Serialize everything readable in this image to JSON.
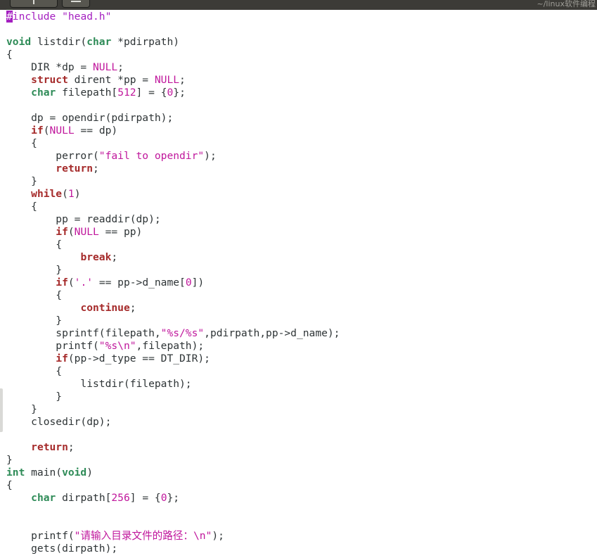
{
  "window": {
    "title": "~/linux软件编程"
  },
  "editor": {
    "lines": [
      [
        {
          "t": "#",
          "c": "hl"
        },
        {
          "t": "include \"head.h\"",
          "c": "pp"
        }
      ],
      [],
      [
        {
          "t": "void",
          "c": "ty"
        },
        {
          "t": " listdir("
        },
        {
          "t": "char",
          "c": "ty"
        },
        {
          "t": " *pdirpath)"
        }
      ],
      [
        {
          "t": "{"
        }
      ],
      [
        {
          "t": "    DIR *dp = "
        },
        {
          "t": "NULL",
          "c": "num"
        },
        {
          "t": ";"
        }
      ],
      [
        {
          "t": "    "
        },
        {
          "t": "struct",
          "c": "kw"
        },
        {
          "t": " dirent *pp = "
        },
        {
          "t": "NULL",
          "c": "num"
        },
        {
          "t": ";"
        }
      ],
      [
        {
          "t": "    "
        },
        {
          "t": "char",
          "c": "ty"
        },
        {
          "t": " filepath["
        },
        {
          "t": "512",
          "c": "num"
        },
        {
          "t": "] = {"
        },
        {
          "t": "0",
          "c": "num"
        },
        {
          "t": "};"
        }
      ],
      [],
      [
        {
          "t": "    dp = opendir(pdirpath);"
        }
      ],
      [
        {
          "t": "    "
        },
        {
          "t": "if",
          "c": "kw"
        },
        {
          "t": "("
        },
        {
          "t": "NULL",
          "c": "num"
        },
        {
          "t": " == dp)"
        }
      ],
      [
        {
          "t": "    {"
        }
      ],
      [
        {
          "t": "        perror("
        },
        {
          "t": "\"fail to opendir\"",
          "c": "str"
        },
        {
          "t": ");"
        }
      ],
      [
        {
          "t": "        "
        },
        {
          "t": "return",
          "c": "kw"
        },
        {
          "t": ";"
        }
      ],
      [
        {
          "t": "    }"
        }
      ],
      [
        {
          "t": "    "
        },
        {
          "t": "while",
          "c": "kw"
        },
        {
          "t": "("
        },
        {
          "t": "1",
          "c": "num"
        },
        {
          "t": ")"
        }
      ],
      [
        {
          "t": "    {"
        }
      ],
      [
        {
          "t": "        pp = readdir(dp);"
        }
      ],
      [
        {
          "t": "        "
        },
        {
          "t": "if",
          "c": "kw"
        },
        {
          "t": "("
        },
        {
          "t": "NULL",
          "c": "num"
        },
        {
          "t": " == pp)"
        }
      ],
      [
        {
          "t": "        {"
        }
      ],
      [
        {
          "t": "            "
        },
        {
          "t": "break",
          "c": "kw"
        },
        {
          "t": ";"
        }
      ],
      [
        {
          "t": "        }"
        }
      ],
      [
        {
          "t": "        "
        },
        {
          "t": "if",
          "c": "kw"
        },
        {
          "t": "("
        },
        {
          "t": "'.'",
          "c": "str"
        },
        {
          "t": " == pp->d_name["
        },
        {
          "t": "0",
          "c": "num"
        },
        {
          "t": "])"
        }
      ],
      [
        {
          "t": "        {"
        }
      ],
      [
        {
          "t": "            "
        },
        {
          "t": "continue",
          "c": "kw"
        },
        {
          "t": ";"
        }
      ],
      [
        {
          "t": "        }"
        }
      ],
      [
        {
          "t": "        sprintf(filepath,"
        },
        {
          "t": "\"%s/%s\"",
          "c": "str"
        },
        {
          "t": ",pdirpath,pp->d_name);"
        }
      ],
      [
        {
          "t": "        printf("
        },
        {
          "t": "\"%s\\n\"",
          "c": "str"
        },
        {
          "t": ",filepath);"
        }
      ],
      [
        {
          "t": "        "
        },
        {
          "t": "if",
          "c": "kw"
        },
        {
          "t": "(pp->d_type == DT_DIR);"
        }
      ],
      [
        {
          "t": "        {"
        }
      ],
      [
        {
          "t": "            listdir(filepath);"
        }
      ],
      [
        {
          "t": "        }"
        }
      ],
      [
        {
          "t": "    }"
        }
      ],
      [
        {
          "t": "    closedir(dp);"
        }
      ],
      [],
      [
        {
          "t": "    "
        },
        {
          "t": "return",
          "c": "kw"
        },
        {
          "t": ";"
        }
      ],
      [
        {
          "t": "}"
        }
      ],
      [
        {
          "t": "int",
          "c": "ty"
        },
        {
          "t": " main("
        },
        {
          "t": "void",
          "c": "ty"
        },
        {
          "t": ")"
        }
      ],
      [
        {
          "t": "{"
        }
      ],
      [
        {
          "t": "    "
        },
        {
          "t": "char",
          "c": "ty"
        },
        {
          "t": " dirpath["
        },
        {
          "t": "256",
          "c": "num"
        },
        {
          "t": "] = {"
        },
        {
          "t": "0",
          "c": "num"
        },
        {
          "t": "};"
        }
      ],
      [],
      [],
      [
        {
          "t": "    printf("
        },
        {
          "t": "\"请输入目录文件的路径：\\n\"",
          "c": "str"
        },
        {
          "t": ");"
        }
      ],
      [
        {
          "t": "    gets(dirpath);"
        }
      ]
    ]
  }
}
